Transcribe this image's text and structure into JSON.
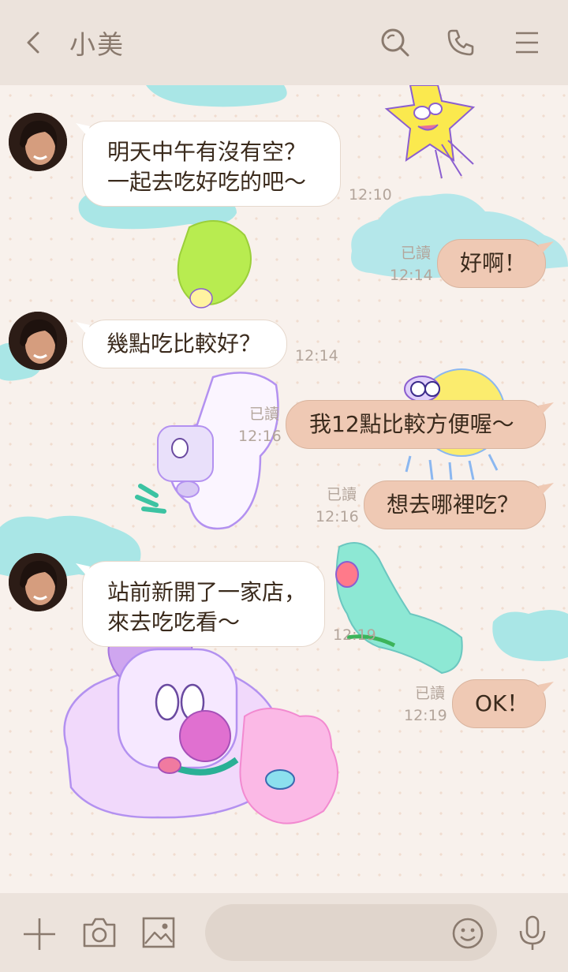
{
  "header": {
    "title": "小美"
  },
  "messages": [
    {
      "side": "in",
      "lines": [
        "明天中午有沒有空？",
        "一起去吃好吃的吧～"
      ],
      "time": "12:10"
    },
    {
      "side": "out",
      "text": "好啊！",
      "read": "已讀",
      "time": "12:14"
    },
    {
      "side": "in",
      "text": "幾點吃比較好？",
      "time": "12:14"
    },
    {
      "side": "out",
      "text": "我12點比較方便喔～",
      "read": "已讀",
      "time": "12:16"
    },
    {
      "side": "out",
      "text": "想去哪裡吃？",
      "read": "已讀",
      "time": "12:16"
    },
    {
      "side": "in",
      "lines": [
        "站前新開了一家店，",
        "來去吃吃看～"
      ],
      "time": "12:19"
    },
    {
      "side": "out",
      "text": "OK！",
      "read": "已讀",
      "time": "12:19"
    }
  ],
  "colors": {
    "header_bg": "#ece3dc",
    "chat_bg": "#f8f1ec",
    "outgoing_bubble": "#efc9b4",
    "incoming_bubble": "#ffffff",
    "icon_color": "#8a7a6e"
  },
  "icons": {
    "back": "chevron-left-icon",
    "search": "search-icon",
    "call": "phone-icon",
    "menu": "hamburger-menu-icon",
    "add": "plus-icon",
    "camera": "camera-icon",
    "image": "image-icon",
    "emoji": "emoji-icon",
    "voice": "microphone-icon"
  }
}
